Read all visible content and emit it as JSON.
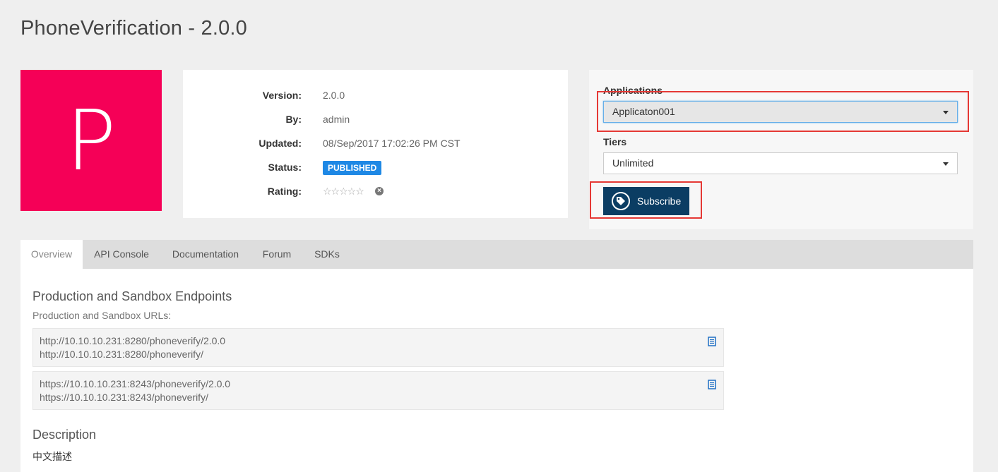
{
  "header": {
    "title": "PhoneVerification - 2.0.0"
  },
  "logo": {
    "letter": "P",
    "color": "#f50057"
  },
  "info": {
    "version_label": "Version:",
    "version_value": "2.0.0",
    "by_label": "By:",
    "by_value": "admin",
    "updated_label": "Updated:",
    "updated_value": "08/Sep/2017 17:02:26 PM CST",
    "status_label": "Status:",
    "status_value": "PUBLISHED",
    "rating_label": "Rating:",
    "rating_stars": "☆☆☆☆☆"
  },
  "subscription": {
    "applications_label": "Applications",
    "application_selected": "Applicaton001",
    "tiers_label": "Tiers",
    "tier_selected": "Unlimited",
    "subscribe_label": "Subscribe"
  },
  "tabs": [
    "Overview",
    "API Console",
    "Documentation",
    "Forum",
    "SDKs"
  ],
  "overview": {
    "endpoints_title": "Production and Sandbox Endpoints",
    "endpoints_subtitle": "Production and Sandbox URLs:",
    "endpoints": [
      {
        "lines": [
          "http://10.10.10.231:8280/phoneverify/2.0.0",
          "http://10.10.10.231:8280/phoneverify/"
        ]
      },
      {
        "lines": [
          "https://10.10.10.231:8243/phoneverify/2.0.0",
          "https://10.10.10.231:8243/phoneverify/"
        ]
      }
    ],
    "description_title": "Description",
    "description_text": "中文描述"
  },
  "colors": {
    "accent": "#0b3d63",
    "badge": "#1e88e5",
    "highlight": "#e53935"
  }
}
